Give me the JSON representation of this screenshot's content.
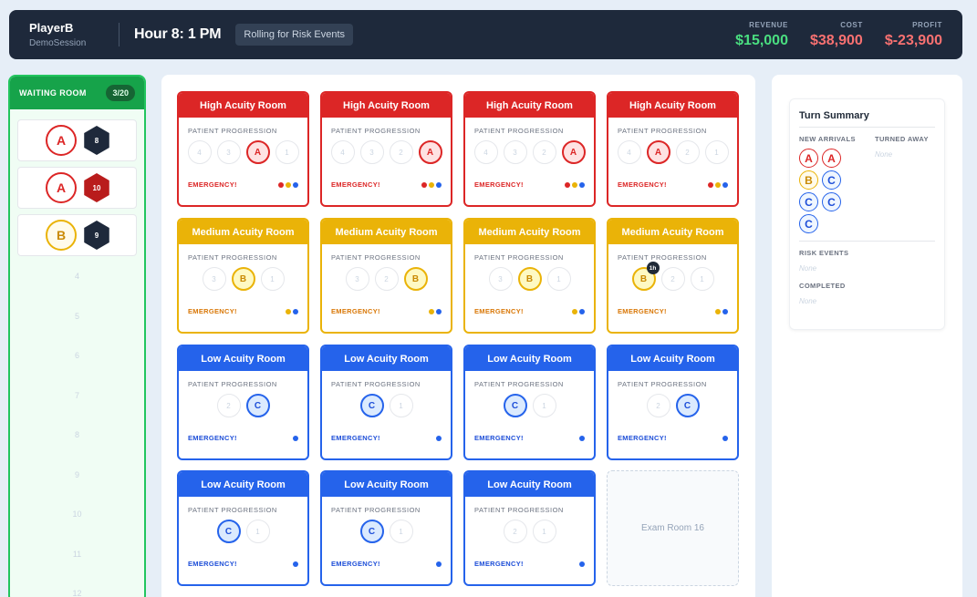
{
  "header": {
    "player": "PlayerB",
    "session": "DemoSession",
    "hour": "Hour 8: 1 PM",
    "phase": "Rolling for Risk Events",
    "metrics": [
      {
        "label": "REVENUE",
        "value": "$15,000",
        "color": "#4ade80"
      },
      {
        "label": "COST",
        "value": "$38,900",
        "color": "#f87171"
      },
      {
        "label": "PROFIT",
        "value": "$-23,900",
        "color": "#f87171"
      }
    ]
  },
  "waiting_room": {
    "title": "WAITING ROOM",
    "count": "3/20",
    "patients": [
      {
        "acuity": "A",
        "die": "8",
        "die_color": "dark"
      },
      {
        "acuity": "A",
        "die": "10",
        "die_color": "red"
      },
      {
        "acuity": "B",
        "die": "9",
        "die_color": "dark"
      }
    ],
    "empty_slots": [
      "4",
      "5",
      "6",
      "7",
      "8",
      "9",
      "10",
      "11",
      "12"
    ]
  },
  "rooms": [
    {
      "name": "High Acuity Room",
      "type": "high",
      "progression_label": "PATIENT PROGRESSION",
      "emergency": "EMERGENCY!",
      "stations": [
        "4",
        "3",
        "A",
        "1"
      ],
      "occupied": 2,
      "dots": [
        "r",
        "y",
        "b"
      ]
    },
    {
      "name": "High Acuity Room",
      "type": "high",
      "progression_label": "PATIENT PROGRESSION",
      "emergency": "EMERGENCY!",
      "stations": [
        "4",
        "3",
        "2",
        "A"
      ],
      "occupied": 3,
      "dots": [
        "r",
        "y",
        "b"
      ]
    },
    {
      "name": "High Acuity Room",
      "type": "high",
      "progression_label": "PATIENT PROGRESSION",
      "emergency": "EMERGENCY!",
      "stations": [
        "4",
        "3",
        "2",
        "A"
      ],
      "occupied": 3,
      "dots": [
        "r",
        "y",
        "b"
      ]
    },
    {
      "name": "High Acuity Room",
      "type": "high",
      "progression_label": "PATIENT PROGRESSION",
      "emergency": "EMERGENCY!",
      "stations": [
        "4",
        "A",
        "2",
        "1"
      ],
      "occupied": 1,
      "dots": [
        "r",
        "y",
        "b"
      ]
    },
    {
      "name": "Medium Acuity Room",
      "type": "med",
      "progression_label": "PATIENT PROGRESSION",
      "emergency": "EMERGENCY!",
      "stations": [
        "3",
        "B",
        "1"
      ],
      "occupied": 1,
      "dots": [
        "y",
        "b"
      ]
    },
    {
      "name": "Medium Acuity Room",
      "type": "med",
      "progression_label": "PATIENT PROGRESSION",
      "emergency": "EMERGENCY!",
      "stations": [
        "3",
        "2",
        "B"
      ],
      "occupied": 2,
      "dots": [
        "y",
        "b"
      ]
    },
    {
      "name": "Medium Acuity Room",
      "type": "med",
      "progression_label": "PATIENT PROGRESSION",
      "emergency": "EMERGENCY!",
      "stations": [
        "3",
        "B",
        "1"
      ],
      "occupied": 1,
      "dots": [
        "y",
        "b"
      ]
    },
    {
      "name": "Medium Acuity Room",
      "type": "med",
      "progression_label": "PATIENT PROGRESSION",
      "emergency": "EMERGENCY!",
      "stations": [
        "B",
        "2",
        "1"
      ],
      "occupied": 0,
      "timer": "1h",
      "dots": [
        "y",
        "b"
      ]
    },
    {
      "name": "Low Acuity Room",
      "type": "low",
      "progression_label": "PATIENT PROGRESSION",
      "emergency": "EMERGENCY!",
      "stations": [
        "2",
        "C"
      ],
      "occupied": 1,
      "dots": [
        "b"
      ]
    },
    {
      "name": "Low Acuity Room",
      "type": "low",
      "progression_label": "PATIENT PROGRESSION",
      "emergency": "EMERGENCY!",
      "stations": [
        "C",
        "1"
      ],
      "occupied": 0,
      "dots": [
        "b"
      ]
    },
    {
      "name": "Low Acuity Room",
      "type": "low",
      "progression_label": "PATIENT PROGRESSION",
      "emergency": "EMERGENCY!",
      "stations": [
        "C",
        "1"
      ],
      "occupied": 0,
      "dots": [
        "b"
      ]
    },
    {
      "name": "Low Acuity Room",
      "type": "low",
      "progression_label": "PATIENT PROGRESSION",
      "emergency": "EMERGENCY!",
      "stations": [
        "2",
        "C"
      ],
      "occupied": 1,
      "dots": [
        "b"
      ]
    },
    {
      "name": "Low Acuity Room",
      "type": "low",
      "progression_label": "PATIENT PROGRESSION",
      "emergency": "EMERGENCY!",
      "stations": [
        "C",
        "1"
      ],
      "occupied": 0,
      "dots": [
        "b"
      ]
    },
    {
      "name": "Low Acuity Room",
      "type": "low",
      "progression_label": "PATIENT PROGRESSION",
      "emergency": "EMERGENCY!",
      "stations": [
        "C",
        "1"
      ],
      "occupied": 0,
      "dots": [
        "b"
      ]
    },
    {
      "name": "Low Acuity Room",
      "type": "low",
      "progression_label": "PATIENT PROGRESSION",
      "emergency": "EMERGENCY!",
      "stations": [
        "2",
        "1"
      ],
      "occupied": -1,
      "dots": [
        "b"
      ]
    }
  ],
  "exam_room": "Exam Room 16",
  "summary": {
    "title": "Turn Summary",
    "new_arrivals_label": "NEW ARRIVALS",
    "turned_away_label": "TURNED AWAY",
    "turned_away_value": "None",
    "arrivals": [
      "A",
      "A",
      "B",
      "C",
      "C",
      "C",
      "C"
    ],
    "risk_events_label": "RISK EVENTS",
    "risk_events_value": "None",
    "completed_label": "COMPLETED",
    "completed_value": "None"
  }
}
